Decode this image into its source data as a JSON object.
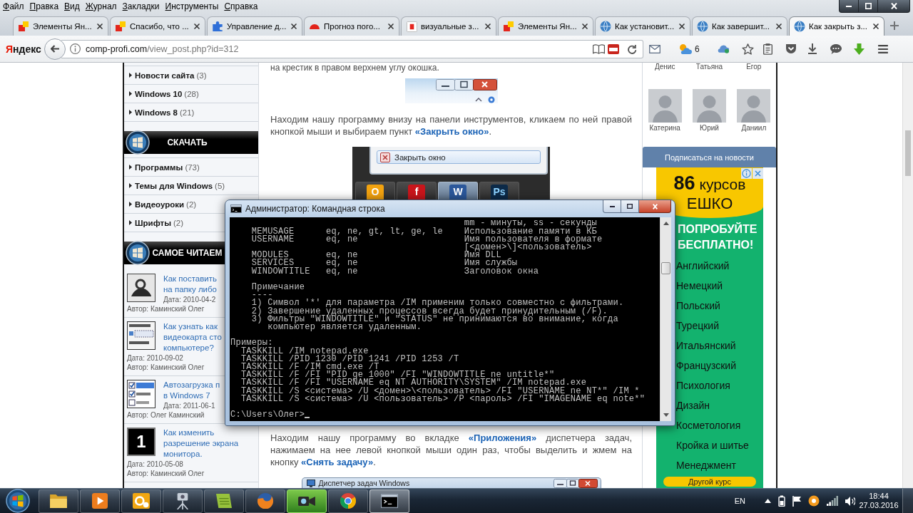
{
  "browser": {
    "menu": [
      "Файл",
      "Правка",
      "Вид",
      "Журнал",
      "Закладки",
      "Инструменты",
      "Справка"
    ],
    "tabs": [
      {
        "title": "Элементы Ян...",
        "kind": "elements",
        "selected": false
      },
      {
        "title": "Спасибо, что ...",
        "kind": "elements",
        "selected": false
      },
      {
        "title": "Управление д...",
        "kind": "puzzle",
        "selected": false
      },
      {
        "title": "Прогноз пого...",
        "kind": "weather",
        "selected": false
      },
      {
        "title": "визуальные з...",
        "kind": "yandex",
        "selected": false
      },
      {
        "title": "Элементы Ян...",
        "kind": "elements",
        "selected": false
      },
      {
        "title": "Как установит...",
        "kind": "site",
        "selected": false
      },
      {
        "title": "Как завершит...",
        "kind": "site",
        "selected": false
      },
      {
        "title": "Как закрыть з...",
        "kind": "site",
        "selected": true
      }
    ],
    "logo": "Яндекс",
    "url": {
      "host": "comp-profi.com",
      "path": "/view_post.php?id=312"
    },
    "weather": "6"
  },
  "sidebar": {
    "categories": [
      {
        "label": "Новости сайта",
        "count": "(3)"
      },
      {
        "label": "Windows 10",
        "count": "(28)"
      },
      {
        "label": "Windows 8",
        "count": "(21)"
      }
    ],
    "downloads": {
      "title": "СКАЧАТЬ",
      "items": [
        {
          "label": "Программы",
          "count": "(73)"
        },
        {
          "label": "Темы для Windows",
          "count": "(5)"
        },
        {
          "label": "Видеоуроки",
          "count": "(2)"
        },
        {
          "label": "Шрифты",
          "count": "(2)"
        }
      ]
    },
    "popular": {
      "title": "САМОЕ ЧИТАЕМ",
      "posts": [
        {
          "kind": "photo",
          "title_lines": [
            "Как поставить",
            "на папку либо"
          ],
          "date": "Дата: 2010-04-2",
          "author": "Автор: Каминский Олег"
        },
        {
          "kind": "screen",
          "title_lines": [
            "Как узнать как",
            "видеокарта сто",
            "компьютере?"
          ],
          "date": "Дата: 2010-09-02",
          "author": "Автор: Каминский Олег"
        },
        {
          "kind": "checks",
          "title_lines": [
            "Автозагрузка п",
            "в Windows 7"
          ],
          "date": "Дата: 2011-06-1",
          "author": "Автор: Олег Каминский"
        },
        {
          "kind": "digit",
          "thumb_label": "1",
          "title_lines": [
            "Как изменить",
            "разрешение экрана",
            "монитора."
          ],
          "date": "Дата: 2010-05-08",
          "author": "Автор: Каминский Олег"
        }
      ]
    }
  },
  "article": {
    "lead": "на крестик в правом верхнем углу окошка.",
    "step": [
      {
        "kind": "text",
        "text": "Находим нашу программу внизу на панели инструментов, кликаем по ней правой кнопкой мыши и выбираем пункт "
      },
      {
        "kind": "link",
        "text": "«Закрыть окно»"
      },
      {
        "kind": "text",
        "text": "."
      }
    ],
    "menu_shot": {
      "item": "Закрыть окно",
      "apps": [
        {
          "kind": "outlook",
          "label": "O",
          "selected": false
        },
        {
          "kind": "flash",
          "label": "f",
          "selected": false
        },
        {
          "kind": "word",
          "label": "W",
          "selected": true
        },
        {
          "kind": "photoshop",
          "label": "Ps",
          "selected": false
        }
      ]
    },
    "next": [
      {
        "kind": "text",
        "text": "Находим нашу программу во вкладке "
      },
      {
        "kind": "link",
        "text": "«Приложения»"
      },
      {
        "kind": "text",
        "text": " диспетчера задач, нажимаем на нее левой кнопкой мыши один раз, чтобы выделить и жмем на кнопку "
      },
      {
        "kind": "link",
        "text": "«Снять задачу»"
      },
      {
        "kind": "text",
        "text": "."
      }
    ],
    "task_manager_title": "Диспетчер задач Windows"
  },
  "right": {
    "top_names": [
      "Денис",
      "Татьяна",
      "Егор"
    ],
    "friends": [
      "Катерина",
      "Юрий",
      "Даниил"
    ],
    "subscribe": "Подписаться на новости",
    "ad": {
      "headline": "**86** курсов",
      "brand": "ЕШКО",
      "offer": "ПОПРОБУЙТЕ БЕСПЛАТНО!",
      "courses": [
        "Английский",
        "Немецкий",
        "Польский",
        "Турецкий",
        "Итальянский",
        "Французский",
        "Психология",
        "Дизайн",
        "Косметология",
        "Кройка и шитье",
        "Менеджмент"
      ],
      "button": "Другой курс"
    }
  },
  "console": {
    "title": "Администратор: Командная строка",
    "filters": [
      {
        "description": "mm - минуты, ss - секунды"
      },
      {
        "name": "MEMUSAGE",
        "operators": "eq, ne, gt, lt, ge, le",
        "description": "Использование памяти в КБ"
      },
      {
        "name": "USERNAME",
        "operators": "eq, ne",
        "description": "Имя пользователя в формате"
      },
      {
        "description": "[<домен>\\]<пользователь>"
      },
      {
        "name": "MODULES",
        "operators": "eq, ne",
        "description": "Имя DLL"
      },
      {
        "name": "SERVICES",
        "operators": "eq, ne",
        "description": "Имя службы"
      },
      {
        "name": "WINDOWTITLE",
        "operators": "eq, ne",
        "description": "Заголовок окна"
      }
    ],
    "notes_title": "Примечание",
    "notes_rule": "----",
    "notes": [
      {
        "number": "1)",
        "text": "Символ '*' для параметра /IM применим только совместно с фильтрами."
      },
      {
        "number": "2)",
        "text": "Завершение удаленных процессов всегда будет принудительным (/F)."
      },
      {
        "number": "3)",
        "text": "Фильтры \"WINDOWTITLE\" и \"STATUS\" не принимаются во внимание, когда компьютер является удаленным."
      }
    ],
    "examples_title": "Примеры:",
    "examples": [
      "TASKKILL /IM notepad.exe",
      "TASKKILL /PID 1230 /PID 1241 /PID 1253 /T",
      "TASKKILL /F /IM cmd.exe /T",
      "TASKKILL /F /FI \"PID ge 1000\" /FI \"WINDOWTITLE ne untitle*\"",
      "TASKKILL /F /FI \"USERNAME eq NT AUTHORITY\\SYSTEM\" /IM notepad.exe",
      "TASKKILL /S <система> /U <домен>\\<пользователь> /FI \"USERNAME ne NT*\" /IM *",
      "TASKKILL /S <система> /U <пользователь> /P <пароль> /FI \"IMAGENAME eq note*\""
    ],
    "prompt": "C:\\Users\\Олег>"
  },
  "taskbar": {
    "apps": [
      {
        "kind": "folder",
        "selected": false,
        "attention": false
      },
      {
        "kind": "player",
        "selected": false,
        "attention": false
      },
      {
        "kind": "outlook",
        "selected": false,
        "attention": false
      },
      {
        "kind": "projector",
        "selected": false,
        "attention": false
      },
      {
        "kind": "notes",
        "selected": false,
        "attention": false
      },
      {
        "kind": "firefox",
        "selected": false,
        "attention": false
      },
      {
        "kind": "camera",
        "selected": false,
        "attention": true
      },
      {
        "kind": "chrome",
        "selected": false,
        "attention": false
      },
      {
        "kind": "console",
        "selected": true,
        "attention": false
      }
    ],
    "language": "EN",
    "time": "18:44",
    "date": "27.03.2016"
  }
}
